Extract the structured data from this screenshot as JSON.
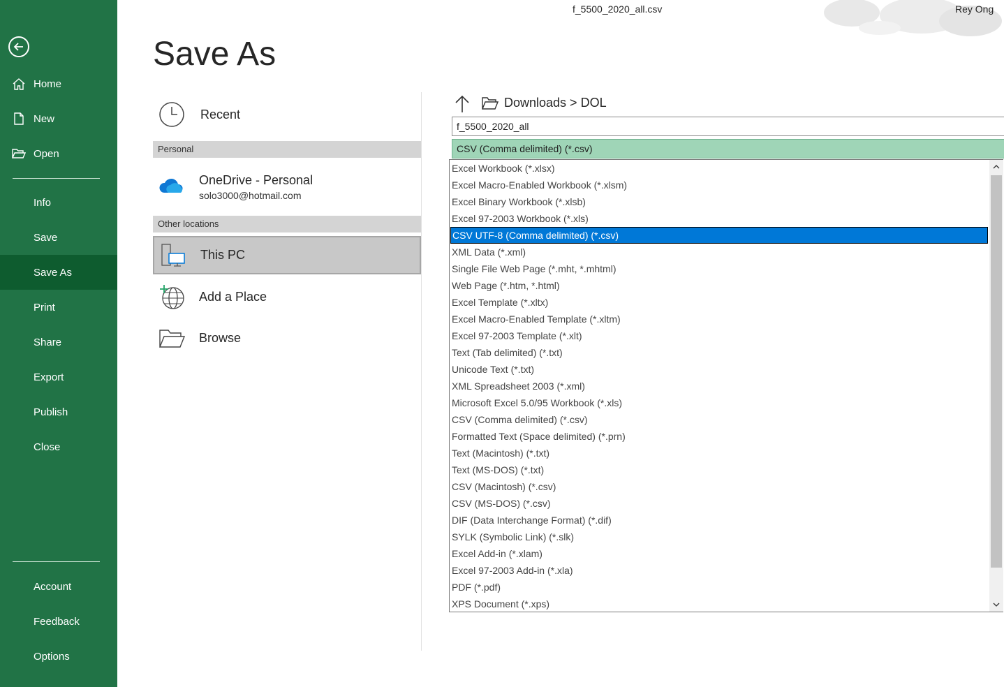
{
  "window": {
    "document_title": "f_5500_2020_all.csv",
    "user": "Rey Ong"
  },
  "sidebar": {
    "items": [
      {
        "label": "Home",
        "icon": "home-icon"
      },
      {
        "label": "New",
        "icon": "new-file-icon"
      },
      {
        "label": "Open",
        "icon": "folder-open-icon"
      },
      {
        "label": "Info"
      },
      {
        "label": "Save"
      },
      {
        "label": "Save As",
        "active": true
      },
      {
        "label": "Print"
      },
      {
        "label": "Share"
      },
      {
        "label": "Export"
      },
      {
        "label": "Publish"
      },
      {
        "label": "Close"
      }
    ],
    "bottom_items": [
      {
        "label": "Account"
      },
      {
        "label": "Feedback"
      },
      {
        "label": "Options"
      }
    ]
  },
  "page": {
    "title": "Save As"
  },
  "locations": {
    "recent_label": "Recent",
    "personal_header": "Personal",
    "onedrive_label": "OneDrive - Personal",
    "onedrive_email": "solo3000@hotmail.com",
    "other_header": "Other locations",
    "this_pc_label": "This PC",
    "add_place_label": "Add a Place",
    "browse_label": "Browse"
  },
  "save_panel": {
    "breadcrumb": "Downloads > DOL",
    "filename": "f_5500_2020_all",
    "selected_type": "CSV (Comma delimited) (*.csv)",
    "file_types": [
      "Excel Workbook (*.xlsx)",
      "Excel Macro-Enabled Workbook (*.xlsm)",
      "Excel Binary Workbook (*.xlsb)",
      "Excel 97-2003 Workbook (*.xls)",
      "CSV UTF-8 (Comma delimited) (*.csv)",
      "XML Data (*.xml)",
      "Single File Web Page (*.mht, *.mhtml)",
      "Web Page (*.htm, *.html)",
      "Excel Template (*.xltx)",
      "Excel Macro-Enabled Template (*.xltm)",
      "Excel 97-2003 Template (*.xlt)",
      "Text (Tab delimited) (*.txt)",
      "Unicode Text (*.txt)",
      "XML Spreadsheet 2003 (*.xml)",
      "Microsoft Excel 5.0/95 Workbook (*.xls)",
      "CSV (Comma delimited) (*.csv)",
      "Formatted Text (Space delimited) (*.prn)",
      "Text (Macintosh) (*.txt)",
      "Text (MS-DOS) (*.txt)",
      "CSV (Macintosh) (*.csv)",
      "CSV (MS-DOS) (*.csv)",
      "DIF (Data Interchange Format) (*.dif)",
      "SYLK (Symbolic Link) (*.slk)",
      "Excel Add-in (*.xlam)",
      "Excel 97-2003 Add-in (*.xla)",
      "PDF (*.pdf)",
      "XPS Document (*.xps)"
    ],
    "highlighted_index": 4
  },
  "colors": {
    "sidebar": "#217346",
    "sidebar_active": "#0e5c2f",
    "selection": "#0078d7",
    "type_select": "#9fd5b7"
  }
}
